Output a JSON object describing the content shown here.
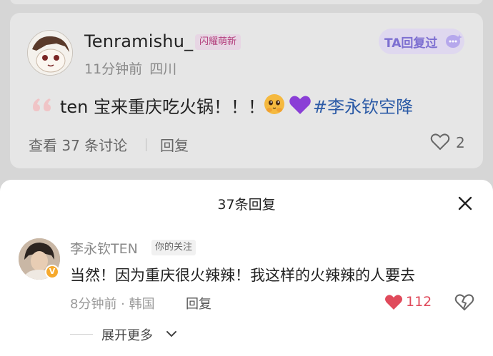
{
  "comment": {
    "username": "Tenramishu_",
    "fan_badge": "闪耀萌新",
    "ta_replied": "TA回复过",
    "time": "11分钟前",
    "location": "四川",
    "text": "ten 宝来重庆吃火锅！！！",
    "hashtag": "#李永钦空降",
    "view_discussions": "查看 37 条讨论",
    "reply_label": "回复",
    "like_count": "2"
  },
  "sheet": {
    "title": "37条回复",
    "reply": {
      "username": "李永钦TEN",
      "follow_tag": "你的关注",
      "text": "当然！因为重庆很火辣辣！我这样的火辣辣的人要去",
      "meta": "8分钟前 · 韩国",
      "reply_label": "回复",
      "like_count": "112",
      "verified_badge": "V"
    },
    "expand_more": "展开更多"
  },
  "colors": {
    "accent_blue": "#2b5aa6",
    "heart_red": "#e04a5b",
    "badge_pink": "#b4417e",
    "ta_purple": "#7d6fd1"
  }
}
